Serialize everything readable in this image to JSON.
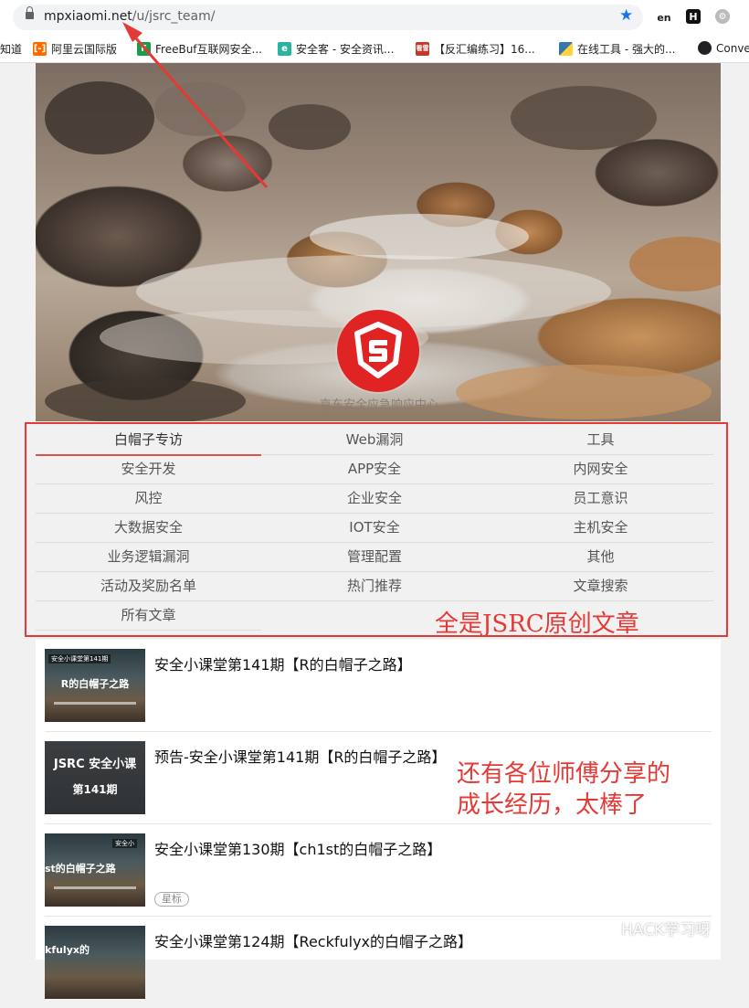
{
  "browser": {
    "url_host": "mpxiaomi.net",
    "url_path": "/u/jsrc_team/",
    "ext_en": "en",
    "ext_h": "H",
    "bookmarks": [
      {
        "label": "知道",
        "icon": "bookmark-icon"
      },
      {
        "label": "阿里云国际版",
        "icon": "aliyun-icon"
      },
      {
        "label": "FreeBuf互联网安全...",
        "icon": "freebuf-icon"
      },
      {
        "label": "安全客 - 安全资讯...",
        "icon": "anquanke-icon"
      },
      {
        "label": "【反汇编练习】16...",
        "icon": "kanxue-icon"
      },
      {
        "label": "在线工具 - 强大的...",
        "icon": "python-icon"
      },
      {
        "label": "Conve",
        "icon": "globe-icon"
      }
    ]
  },
  "hero": {
    "caption": "京东安全应急响应中心"
  },
  "menu": {
    "items": [
      [
        "白帽子专访",
        "Web漏洞",
        "工具"
      ],
      [
        "安全开发",
        "APP安全",
        "内网安全"
      ],
      [
        "风控",
        "企业安全",
        "员工意识"
      ],
      [
        "大数据安全",
        "IOT安全",
        "主机安全"
      ],
      [
        "业务逻辑漏洞",
        "管理配置",
        "其他"
      ],
      [
        "活动及奖励名单",
        "热门推荐",
        "文章搜索"
      ],
      [
        "所有文章"
      ]
    ]
  },
  "annotations": {
    "box_note": "全是JSRC原创文章",
    "note_line1": "还有各位师傅分享的",
    "note_line2": "成长经历，太棒了"
  },
  "articles": [
    {
      "title": "安全小课堂第141期【R的白帽子之路】",
      "thumb_top": "安全小课堂第141期",
      "thumb_big": "R的白帽子之路"
    },
    {
      "title": "预告-安全小课堂第141期【R的白帽子之路】",
      "thumb_top": "JSRC 安全小课",
      "thumb_big": "第141期"
    },
    {
      "title": "安全小课堂第130期【ch1st的白帽子之路】",
      "thumb_top": "安全小",
      "thumb_big": "st的白帽子之路",
      "tag": "星标"
    },
    {
      "title": "安全小课堂第124期【Reckfulyx的白帽子之路】",
      "thumb_top": "",
      "thumb_big": "kfulyx的"
    }
  ],
  "watermark": "HACK学习呀",
  "colors": {
    "accent": "#e53935",
    "logo": "#e02424",
    "star": "#1a73e8"
  }
}
